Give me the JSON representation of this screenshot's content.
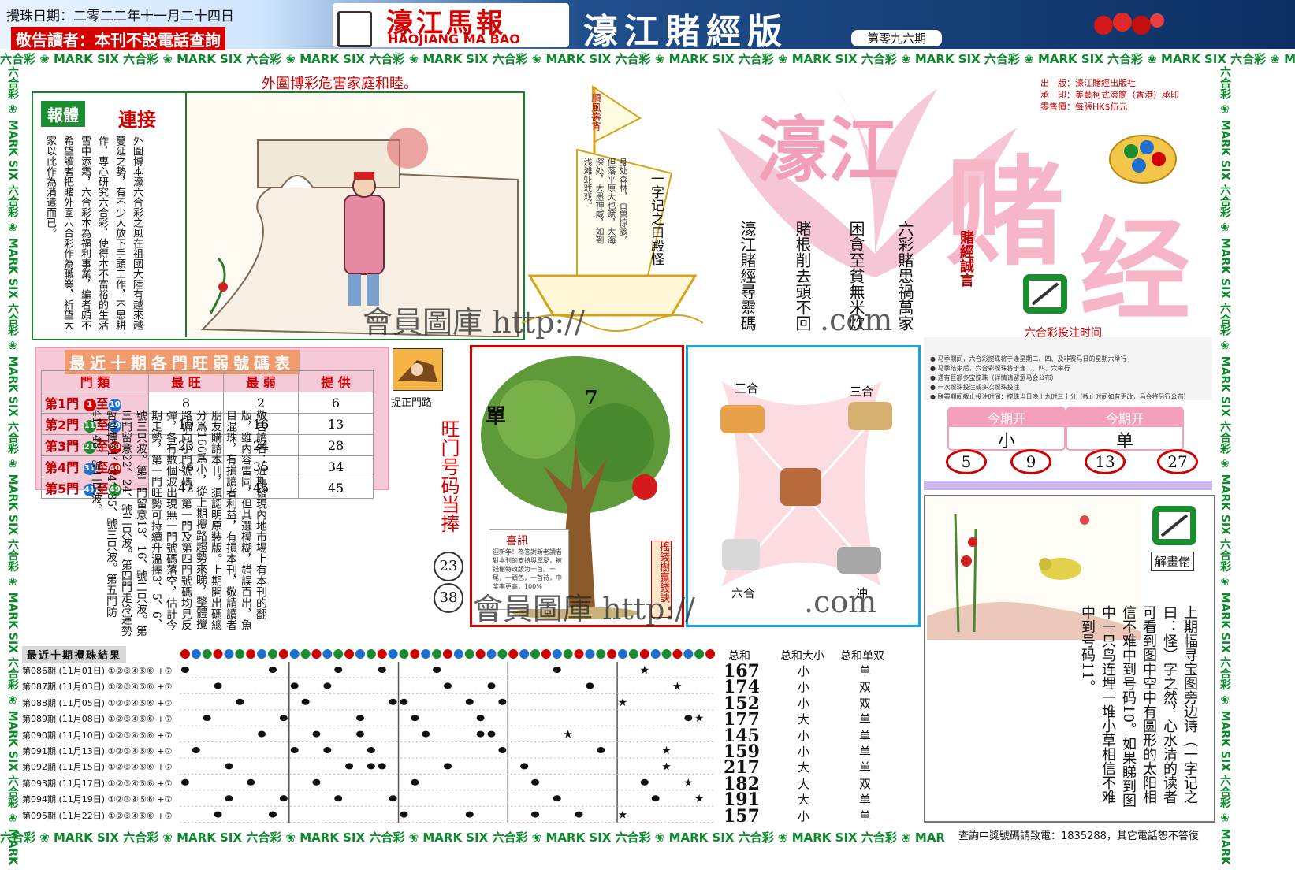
{
  "header": {
    "draw_date": "攪珠日期：二零二二年十一月二十四日",
    "notice": "敬告讀者：本刊不設電話查詢",
    "paper_cn": "濠江馬報",
    "paper_en": "HAOJIANG MA BAO",
    "edition": "濠江賭經版",
    "issue": "第零九六期"
  },
  "strip": {
    "text": "六合彩 ❀ MARK SIX 六合彩 ❀ MARK SIX 六合彩 ❀ MARK SIX 六合彩 ❀ MARK SIX 六合彩 ❀ MARK SIX 六合彩 ❀ MARK SIX 六合彩 ❀ MARK SIX 六合彩 ❀ MARK SIX 六合彩 ❀ MARK SIX 六合彩 ❀ MARK SIX 六合彩 ❀ MARK SIX"
  },
  "slogan": "外圍博彩危害家庭和睦。",
  "comic": {
    "title_a": "報體",
    "title_b": "連接",
    "text": "外圍博本濠六合彩之風在祖國大陸有越來越蔓延之勢，有不少人放下手頭工作，不思耕作，專心研究六合彩，使得本不富裕的生活雪中添霜，六合彩本為福利事業，編者頗不希望讀者把賭外圍六合彩作為職業，祈望大家以此作為消遣而已。"
  },
  "boat": {
    "flag": "順風壽宵",
    "title": "一字记之曰殿怪",
    "small": "身处森林，百兽惊骇，但落平原大也赋，大海深处，大墨神威，如到浅滩虾戏戏。"
  },
  "poem": {
    "line1": "六彩賭患禍萬家",
    "line2": "困貪至貧無米炊",
    "line3": "賭根削去頭不回",
    "line4": "濠江賭經尋靈碼",
    "tag": "賭經誠言"
  },
  "big_title": {
    "a": "濠江",
    "b": "赌",
    "c": "经"
  },
  "pub_info": {
    "line1": "出　版：濠江賭經出版社",
    "line2": "承　印：美藝柯式滾筒（香港）承印",
    "line3": "零售價：每張HK$伍元"
  },
  "strength_table": {
    "title": "最近十期各門旺弱號碼表",
    "headers": [
      "門 類",
      "最 旺",
      "最 弱",
      "提 供"
    ],
    "rows": [
      {
        "door": "第1門",
        "from": "1",
        "to": "10",
        "strong": "8",
        "weak": "2",
        "offer": "6",
        "c1": "#d00000",
        "c2": "#1f6fd0"
      },
      {
        "door": "第2門",
        "from": "11",
        "to": "20",
        "strong": "19",
        "weak": "16",
        "offer": "13",
        "c1": "#1b8c2f",
        "c2": "#1f6fd0"
      },
      {
        "door": "第3門",
        "from": "21",
        "to": "30",
        "strong": "23",
        "weak": "24",
        "offer": "28",
        "c1": "#1b8c2f",
        "c2": "#d00000"
      },
      {
        "door": "第4門",
        "from": "31",
        "to": "40",
        "strong": "36",
        "weak": "35",
        "offer": "34",
        "c1": "#1f6fd0",
        "c2": "#d00000"
      },
      {
        "door": "第5門",
        "from": "41",
        "to": "49",
        "strong": "42",
        "weak": "45",
        "offer": "45",
        "c1": "#1f6fd0",
        "c2": "#1b8c2f"
      }
    ],
    "zhi": "至"
  },
  "door_note": {
    "label": "捉正門路",
    "text": "敬告讀者：近期發現內地市場上有本刊的翻版，雖內容雷同，但其選模糊，錯誤百出，魚目混珠，有損讀者利益，有損本刊，敬請讀者朋友購請本刊，須認明原裝版。上期開出碼總分爲166爲小，從上期攪路趨勢來睇，整體攪路偏向小門號碼，第一門及第四門號碼均見反彈，各有數個波出現無一門號碼落空，估計今期走勢，第一門旺勢可持續升溫捧3、5、6、號三只波。第二門留意13、16、號二只波。第三門留意22、24、號二只波。第四門走冷運勢暫停博31、34、35、號三只波。第五門防41、48、號二只波。",
    "hot_title": "旺门号码当捧",
    "hot1": "23",
    "hot2": "38"
  },
  "tree": {
    "dan": "單",
    "num": "7",
    "banner": "搖錢樹贏錢訣",
    "note_title": "喜訊",
    "note_text": "迎新年！為答謝新老讀者對本刊的支持與厚愛，被錢樹特改版为一首。一尾，一頭色，一首诗，中奖率更高，100%"
  },
  "zodiac": {
    "top_left": "三合",
    "top_right": "三合",
    "bottom_left": "六合",
    "bottom_right": "冲"
  },
  "schedule": {
    "title": "六合彩投注时间",
    "lines": [
      "● 马季期间，六合彩搅珠将于逢星期二、四、及非赛马日的星期六举行",
      "● 马季结束后，六合彩搅珠将于逢二、四、六举行",
      "● 遇有巨额多宝搅珠（详情请留意马会公布）",
      "● 一次搅珠投注或多次搅珠投注",
      "● 联署期间截止投注时间：搅珠当日晚上九时三十分（截止时间如有更改，马会将另行公布）"
    ]
  },
  "open": {
    "head": "今期开",
    "val1": "小",
    "val2": "单",
    "balls": [
      "5",
      "9",
      "13",
      "27"
    ]
  },
  "puzzle": {
    "label": "解畫佬",
    "text": "上期幅寻宝图旁边诗（一字记之曰：怪）字之然，心水清的读者可看到图中空中有圆形的太阳相信不难中到号码10。如果睇到图中一只鸟连埋一堆小草相信不难中到号码11。"
  },
  "results": {
    "title": "最近十期攪珠結果",
    "sum_head": "总和",
    "bs_head": "总和大小",
    "oe_head": "总和单双",
    "rows": [
      {
        "issue": "第086期",
        "date": "(11月01日)",
        "sum": "167",
        "bs": "小",
        "oe": "单",
        "nums": [
          1,
          9,
          15,
          19,
          24,
          35,
          43
        ]
      },
      {
        "issue": "第087期",
        "date": "(11月03日)",
        "sum": "174",
        "bs": "小",
        "oe": "双",
        "nums": [
          4,
          11,
          14,
          25,
          29,
          38,
          46
        ]
      },
      {
        "issue": "第088期",
        "date": "(11月05日)",
        "sum": "152",
        "bs": "小",
        "oe": "双",
        "nums": [
          6,
          12,
          20,
          21,
          27,
          30,
          41
        ]
      },
      {
        "issue": "第089期",
        "date": "(11月08日)",
        "sum": "177",
        "bs": "大",
        "oe": "单",
        "nums": [
          3,
          10,
          17,
          22,
          28,
          47,
          48
        ]
      },
      {
        "issue": "第090期",
        "date": "(11月10日)",
        "sum": "145",
        "bs": "小",
        "oe": "单",
        "nums": [
          8,
          13,
          17,
          23,
          28,
          29,
          36
        ]
      },
      {
        "issue": "第091期",
        "date": "(11月13日)",
        "sum": "159",
        "bs": "小",
        "oe": "单",
        "nums": [
          2,
          11,
          14,
          18,
          30,
          39,
          45
        ]
      },
      {
        "issue": "第092期",
        "date": "(11月15日)",
        "sum": "217",
        "bs": "大",
        "oe": "单",
        "nums": [
          5,
          16,
          18,
          19,
          25,
          32,
          45
        ]
      },
      {
        "issue": "第093期",
        "date": "(11月17日)",
        "sum": "182",
        "bs": "大",
        "oe": "双",
        "nums": [
          1,
          7,
          13,
          22,
          33,
          43,
          47
        ]
      },
      {
        "issue": "第094期",
        "date": "(11月19日)",
        "sum": "191",
        "bs": "大",
        "oe": "单",
        "nums": [
          5,
          10,
          15,
          20,
          35,
          44,
          48
        ]
      },
      {
        "issue": "第095期",
        "date": "(11月22日)",
        "sum": "157",
        "bs": "小",
        "oe": "单",
        "nums": [
          4,
          9,
          21,
          27,
          33,
          37,
          41
        ]
      }
    ],
    "suffix": "①②③④⑤⑥ +⑦"
  },
  "footer": {
    "tel": "查詢中獎號碼請致電：1835288，其它電話恕不答復"
  },
  "watermark": {
    "a": "會員圖庫 http://",
    "b": ".com",
    "c": "會員圖庫 http://",
    "d": ".com"
  },
  "colors": {
    "red": "#d00000",
    "green": "#1b8c2f",
    "blue": "#1f6fd0",
    "pink": "#f4a0b8"
  }
}
